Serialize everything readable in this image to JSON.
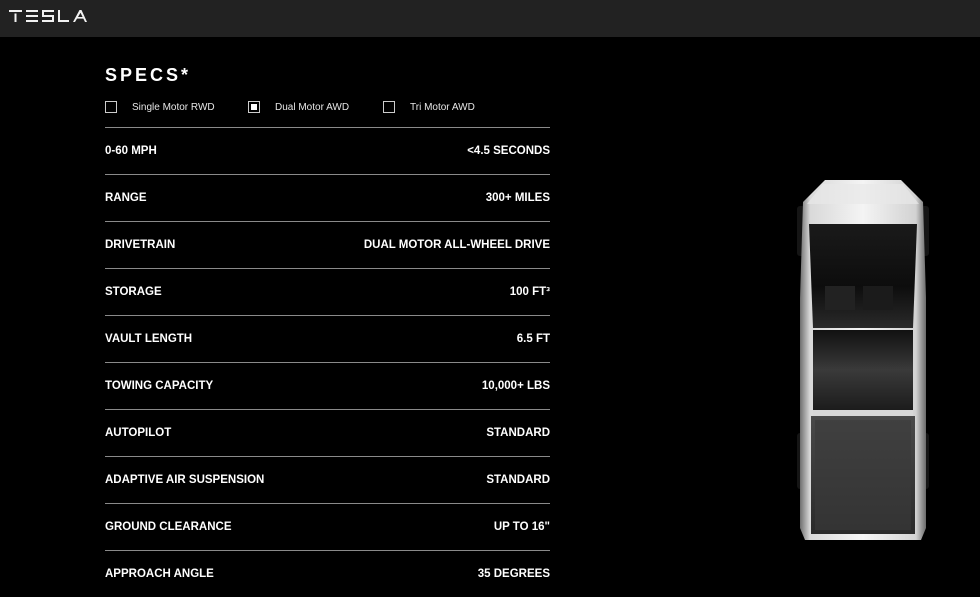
{
  "header": {
    "brand": "TESLA"
  },
  "specs": {
    "title": "SPECS*",
    "variants": [
      {
        "label": "Single Motor RWD",
        "checked": false
      },
      {
        "label": "Dual Motor AWD",
        "checked": true
      },
      {
        "label": "Tri Motor AWD",
        "checked": false
      }
    ],
    "rows": [
      {
        "label": "0-60 MPH",
        "value": "<4.5 SECONDS"
      },
      {
        "label": "RANGE",
        "value": "300+ MILES"
      },
      {
        "label": "DRIVETRAIN",
        "value": "DUAL MOTOR ALL-WHEEL DRIVE"
      },
      {
        "label": "STORAGE",
        "value": "100 FT³"
      },
      {
        "label": "VAULT LENGTH",
        "value": "6.5 FT"
      },
      {
        "label": "TOWING CAPACITY",
        "value": "10,000+ LBS"
      },
      {
        "label": "AUTOPILOT",
        "value": "STANDARD"
      },
      {
        "label": "ADAPTIVE AIR SUSPENSION",
        "value": "STANDARD"
      },
      {
        "label": "GROUND CLEARANCE",
        "value": "UP TO 16\""
      },
      {
        "label": "APPROACH ANGLE",
        "value": "35 DEGREES"
      }
    ]
  },
  "colors": {
    "background": "#000000",
    "topbar": "#222222",
    "divider": "#8a8a8a"
  }
}
